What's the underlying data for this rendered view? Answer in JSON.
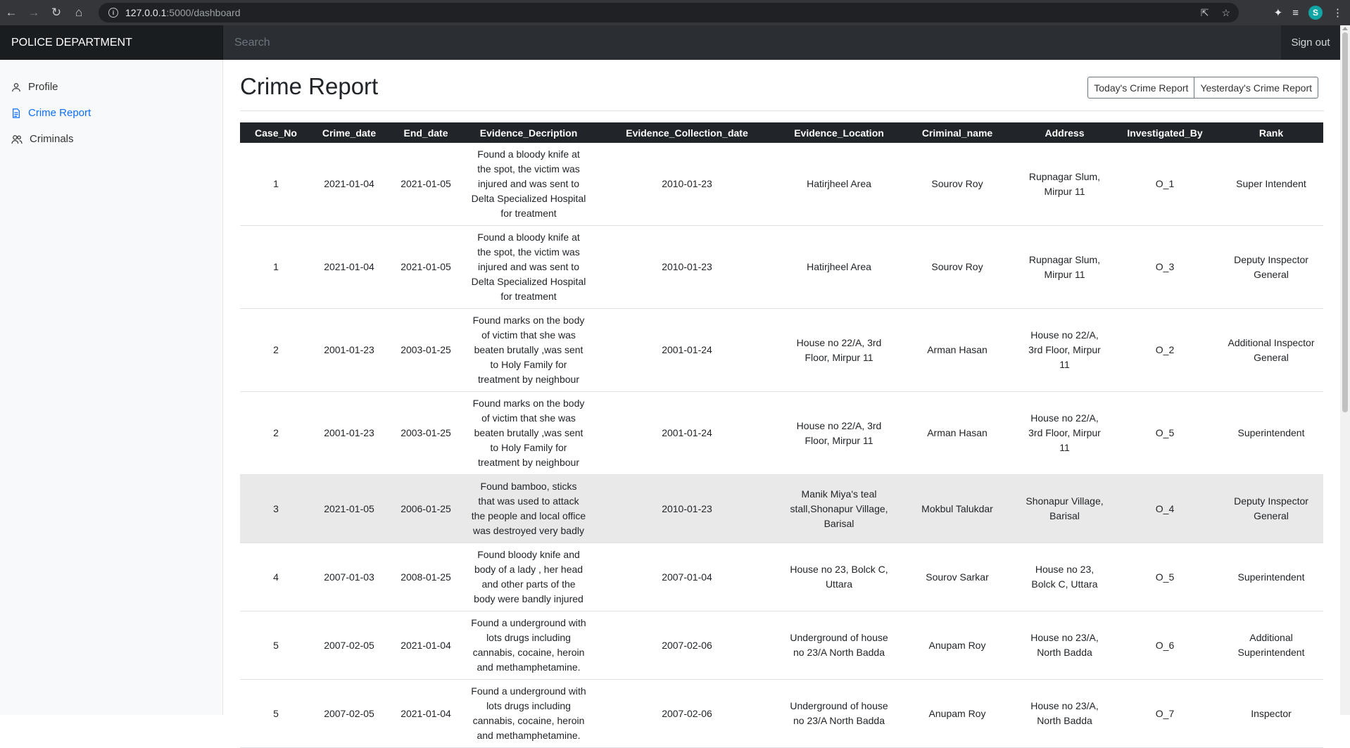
{
  "browser": {
    "url_host": "127.0.0.1",
    "url_path": ":5000/dashboard",
    "profile_initial": "S"
  },
  "navbar": {
    "brand": "POLICE DEPARTMENT",
    "search_placeholder": "Search",
    "signout": "Sign out"
  },
  "sidebar": {
    "items": [
      {
        "label": "Profile",
        "icon": "user-icon"
      },
      {
        "label": "Crime Report",
        "icon": "document-icon"
      },
      {
        "label": "Criminals",
        "icon": "users-icon"
      }
    ],
    "active_color": "#0d6efd"
  },
  "main": {
    "title": "Crime Report",
    "btn_today": "Today's Crime Report",
    "btn_yesterday": "Yesterday's Crime Report"
  },
  "table": {
    "headers": [
      "Case_No",
      "Crime_date",
      "End_date",
      "Evidence_Decription",
      "Evidence_Collection_date",
      "Evidence_Location",
      "Criminal_name",
      "Address",
      "Investigated_By",
      "Rank"
    ],
    "rows": [
      [
        "1",
        "2021-01-04",
        "2021-01-05",
        "Found a bloody knife at the spot, the victim was injured and was sent to Delta Specialized Hospital for treatment",
        "2010-01-23",
        "Hatirjheel Area",
        "Sourov Roy",
        "Rupnagar Slum, Mirpur 11",
        "O_1",
        "Super Intendent"
      ],
      [
        "1",
        "2021-01-04",
        "2021-01-05",
        "Found a bloody knife at the spot, the victim was injured and was sent to Delta Specialized Hospital for treatment",
        "2010-01-23",
        "Hatirjheel Area",
        "Sourov Roy",
        "Rupnagar Slum, Mirpur 11",
        "O_3",
        "Deputy Inspector General"
      ],
      [
        "2",
        "2001-01-23",
        "2003-01-25",
        "Found marks on the body of victim that she was beaten brutally ,was sent to Holy Family for treatment by neighbour",
        "2001-01-24",
        "House no 22/A, 3rd Floor, Mirpur 11",
        "Arman Hasan",
        "House no 22/A, 3rd Floor, Mirpur 11",
        "O_2",
        "Additional Inspector General"
      ],
      [
        "2",
        "2001-01-23",
        "2003-01-25",
        "Found marks on the body of victim that she was beaten brutally ,was sent to Holy Family for treatment by neighbour",
        "2001-01-24",
        "House no 22/A, 3rd Floor, Mirpur 11",
        "Arman Hasan",
        "House no 22/A, 3rd Floor, Mirpur 11",
        "O_5",
        "Superintendent"
      ],
      [
        "3",
        "2021-01-05",
        "2006-01-25",
        "Found bamboo, sticks that was used to attack the people and local office was destroyed very badly",
        "2010-01-23",
        "Manik Miya's teal stall,Shonapur Village, Barisal",
        "Mokbul Talukdar",
        "Shonapur Village, Barisal",
        "O_4",
        "Deputy Inspector General"
      ],
      [
        "4",
        "2007-01-03",
        "2008-01-25",
        "Found bloody knife and body of a lady , her head and other parts of the body were bandly injured",
        "2007-01-04",
        "House no 23, Bolck C, Uttara",
        "Sourov Sarkar",
        "House no 23, Bolck C, Uttara",
        "O_5",
        "Superintendent"
      ],
      [
        "5",
        "2007-02-05",
        "2021-01-04",
        "Found a underground with lots drugs including cannabis, cocaine, heroin and methamphetamine.",
        "2007-02-06",
        "Underground of house no 23/A North Badda",
        "Anupam Roy",
        "House no 23/A, North Badda",
        "O_6",
        "Additional Superintendent"
      ],
      [
        "5",
        "2007-02-05",
        "2021-01-04",
        "Found a underground with lots drugs including cannabis, cocaine, heroin and methamphetamine.",
        "2007-02-06",
        "Underground of house no 23/A North Badda",
        "Anupam Roy",
        "House no 23/A, North Badda",
        "O_7",
        "Inspector"
      ]
    ],
    "highlighted_row_index": 4
  }
}
